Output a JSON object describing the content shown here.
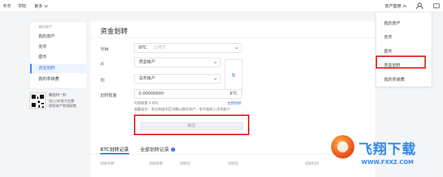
{
  "topbar": {
    "left_items": [
      "币币",
      "学院",
      "更多"
    ],
    "asset_menu": "资产管理"
  },
  "sidebar": {
    "section_title": "我的资产",
    "items": [
      "我的资产",
      "充币",
      "提币",
      "资金划转",
      "我的手续费"
    ],
    "active_index": 3
  },
  "qr": {
    "title": "微信扫一扫",
    "line1": "加入OK官方社群",
    "line2": "获取资产管理秘籍"
  },
  "main": {
    "title": "资金划转",
    "currency_label": "币种",
    "currency_value": "BTC",
    "currency_placeholder": "比特币",
    "from_label": "从",
    "from_value": "资金账户",
    "to_label": "到",
    "to_value": "法币账户",
    "swap_icon": "⇅",
    "amount_label": "划转数量",
    "amount_value": "0.00000000",
    "amount_unit": "BTC",
    "available_text": "可转数量 0 BTC",
    "transfer_all": "全部划转",
    "tip": "温馨提示：未达到提币区块确认数的资产，暂不能转入法币账户",
    "confirm_label": "确定",
    "tabs": [
      "BTC划转记录",
      "全部划转记录"
    ],
    "columns": [
      "划转币种",
      "划转数量",
      "划转自",
      "划转至",
      "划转时间"
    ]
  },
  "dropdown": {
    "items": [
      "我的资产",
      "充币",
      "提币",
      "资金划转",
      "我的手续费"
    ],
    "highlight_index": 3
  },
  "watermark": {
    "title": "飞翔下载",
    "url": "WWW.FXXZ.COM"
  },
  "colors": {
    "accent": "#2d6cf2",
    "highlight_border": "#e0221c",
    "watermark": "#2d86e6"
  }
}
